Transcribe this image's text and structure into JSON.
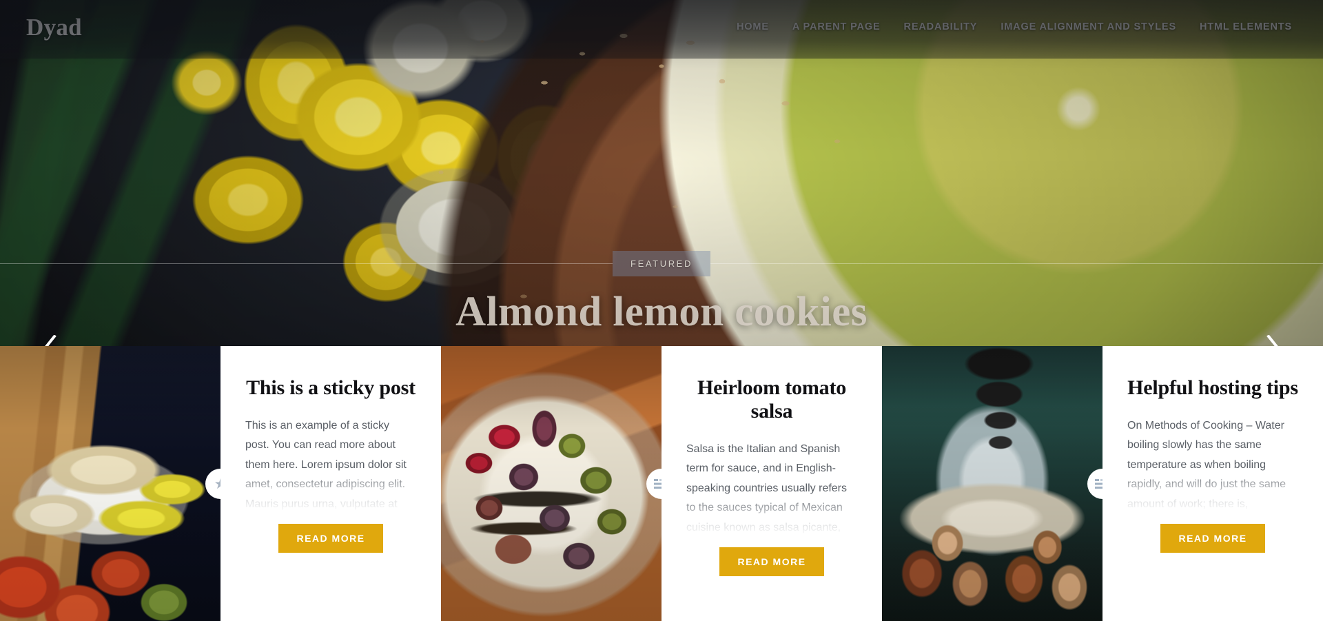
{
  "site": {
    "title": "Dyad"
  },
  "nav": {
    "items": [
      {
        "label": "HOME"
      },
      {
        "label": "A PARENT PAGE"
      },
      {
        "label": "READABILITY"
      },
      {
        "label": "IMAGE ALIGNMENT AND STYLES"
      },
      {
        "label": "HTML ELEMENTS"
      }
    ]
  },
  "hero": {
    "badge": "FEATURED",
    "title": "Almond lemon cookies",
    "prev_icon": "chevron-left-icon",
    "next_icon": "chevron-right-icon"
  },
  "cards": [
    {
      "title": "This is a sticky post",
      "excerpt": "This is an example of a sticky post. You can read more about them here. Lorem ipsum dolor sit amet, consectetur adipiscing elit. Mauris purus urna, vulputate at convallis hendrerit, mattis id mi. Nulla mauris justo, sodales vitae, interdum ac dolor.",
      "read_more": "READ MORE",
      "badge_icon": "star-icon"
    },
    {
      "title": "Heirloom tomato salsa",
      "excerpt": "Salsa is the Italian and Spanish term for sauce, and in English-speaking countries usually refers to the sauces typical of Mexican cuisine known as salsa picante, particularly those used as dips. Salsa is often a tomato based sauce served with chips.",
      "read_more": "READ MORE",
      "badge_icon": "list-icon"
    },
    {
      "title": "Helpful hosting tips",
      "excerpt": "On Methods of Cooking – Water boiling slowly has the same temperature as when boiling rapidly, and will do just the same amount of work; there is, therefore, no object in wasting fuel to keep water boiling rapidly once it has reached a boil.",
      "read_more": "READ MORE",
      "badge_icon": "list-icon"
    }
  ],
  "theme": {
    "accent": "#e0a80d",
    "header_overlay": "#101218",
    "badge_bg": "#7489a8",
    "body_text": "#5a5f66",
    "heading_text": "#111114"
  }
}
